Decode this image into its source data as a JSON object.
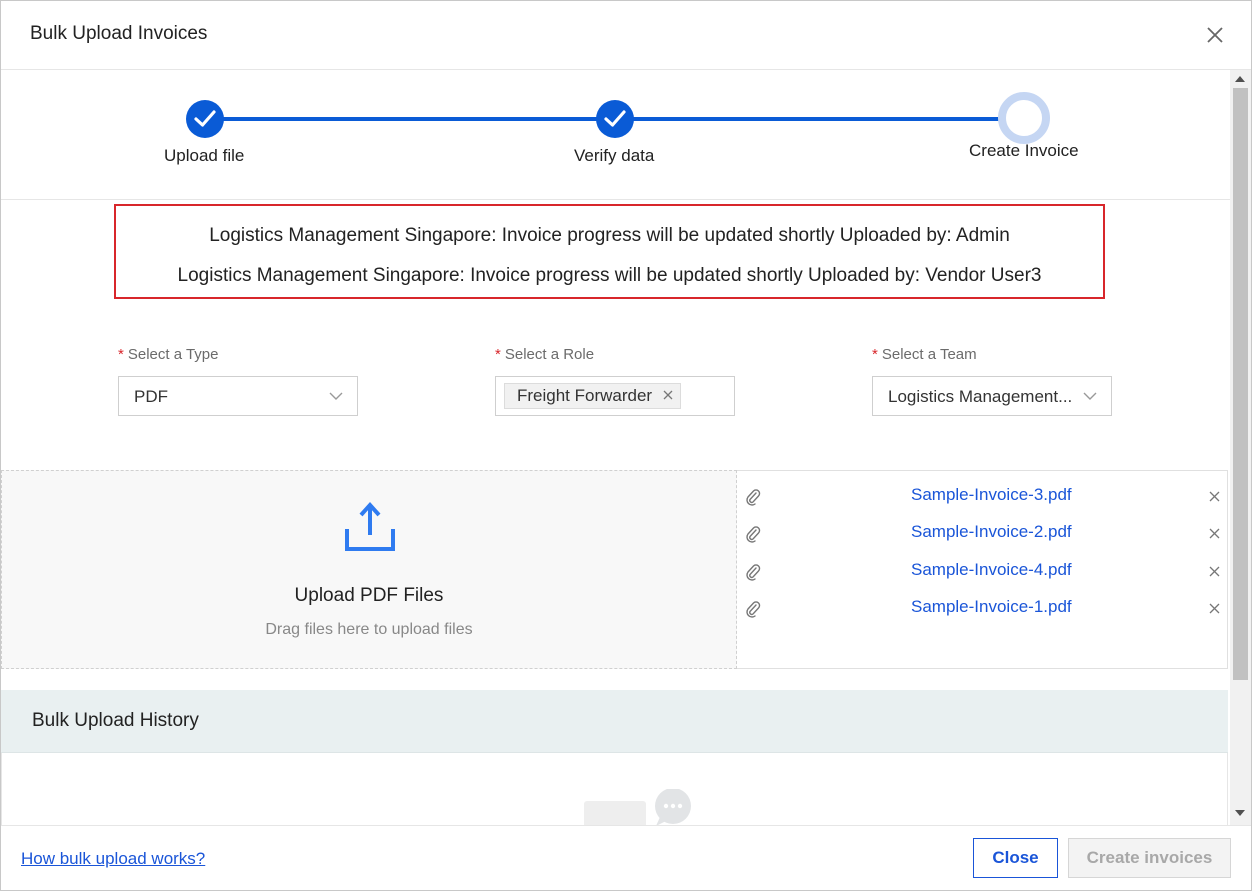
{
  "modal": {
    "title": "Bulk Upload Invoices"
  },
  "stepper": {
    "steps": [
      {
        "label": "Upload file",
        "status": "completed"
      },
      {
        "label": "Verify data",
        "status": "completed"
      },
      {
        "label": "Create Invoice",
        "status": "current"
      }
    ]
  },
  "notices": [
    "Logistics Management Singapore: Invoice progress will be updated shortly Uploaded by: Admin",
    "Logistics Management Singapore: Invoice progress will be updated shortly Uploaded by: Vendor User3"
  ],
  "form": {
    "type": {
      "label": "Select a Type",
      "value": "PDF"
    },
    "role": {
      "label": "Select a Role",
      "tag": "Freight Forwarder"
    },
    "team": {
      "label": "Select a Team",
      "value": "Logistics Management..."
    }
  },
  "dropzone": {
    "title": "Upload PDF Files",
    "subtitle": "Drag files here to upload files"
  },
  "files": [
    "Sample-Invoice-3.pdf",
    "Sample-Invoice-2.pdf",
    "Sample-Invoice-4.pdf",
    "Sample-Invoice-1.pdf"
  ],
  "history": {
    "title": "Bulk Upload History"
  },
  "footer": {
    "help_link": "How bulk upload works?",
    "close_label": "Close",
    "create_label": "Create invoices"
  },
  "colors": {
    "primary": "#0a5bd6",
    "link": "#1a55d8",
    "required": "#d8262b",
    "notice_border": "#d8262b",
    "history_bg": "#e9f0f1"
  }
}
